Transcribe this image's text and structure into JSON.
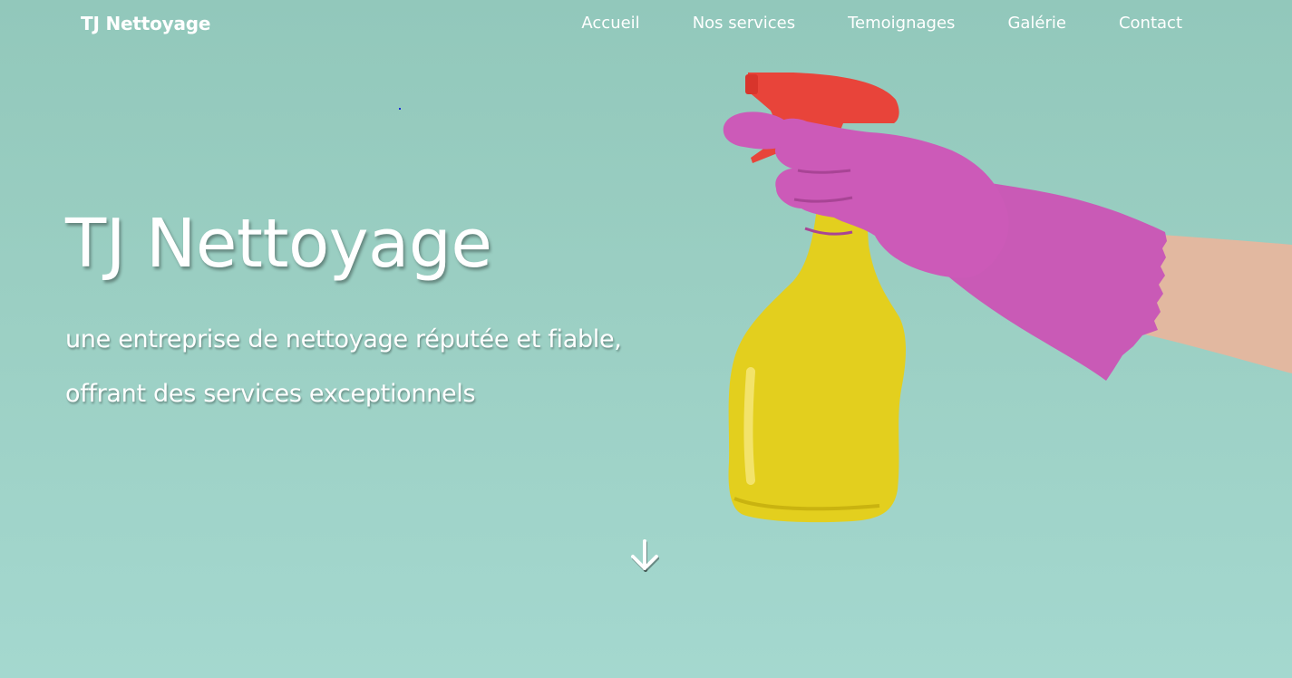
{
  "navbar": {
    "brand": "TJ Nettoyage",
    "links": [
      "Accueil",
      "Nos services",
      "Temoignages",
      "Galérie",
      "Contact"
    ]
  },
  "hero": {
    "title": "TJ Nettoyage",
    "subtitle_line1": "une entreprise de nettoyage réputée et fiable,",
    "subtitle_line2": "offrant des services exceptionnels"
  },
  "icons": {
    "scroll": "arrow-down-icon"
  },
  "colors": {
    "background_top": "#92c8bb",
    "background_bottom": "#a4d8cf",
    "text": "#ffffff",
    "bottle": "#e3cf1e",
    "trigger": "#e8443a",
    "glove": "#cc5ab8",
    "skin": "#e3b9a1"
  }
}
